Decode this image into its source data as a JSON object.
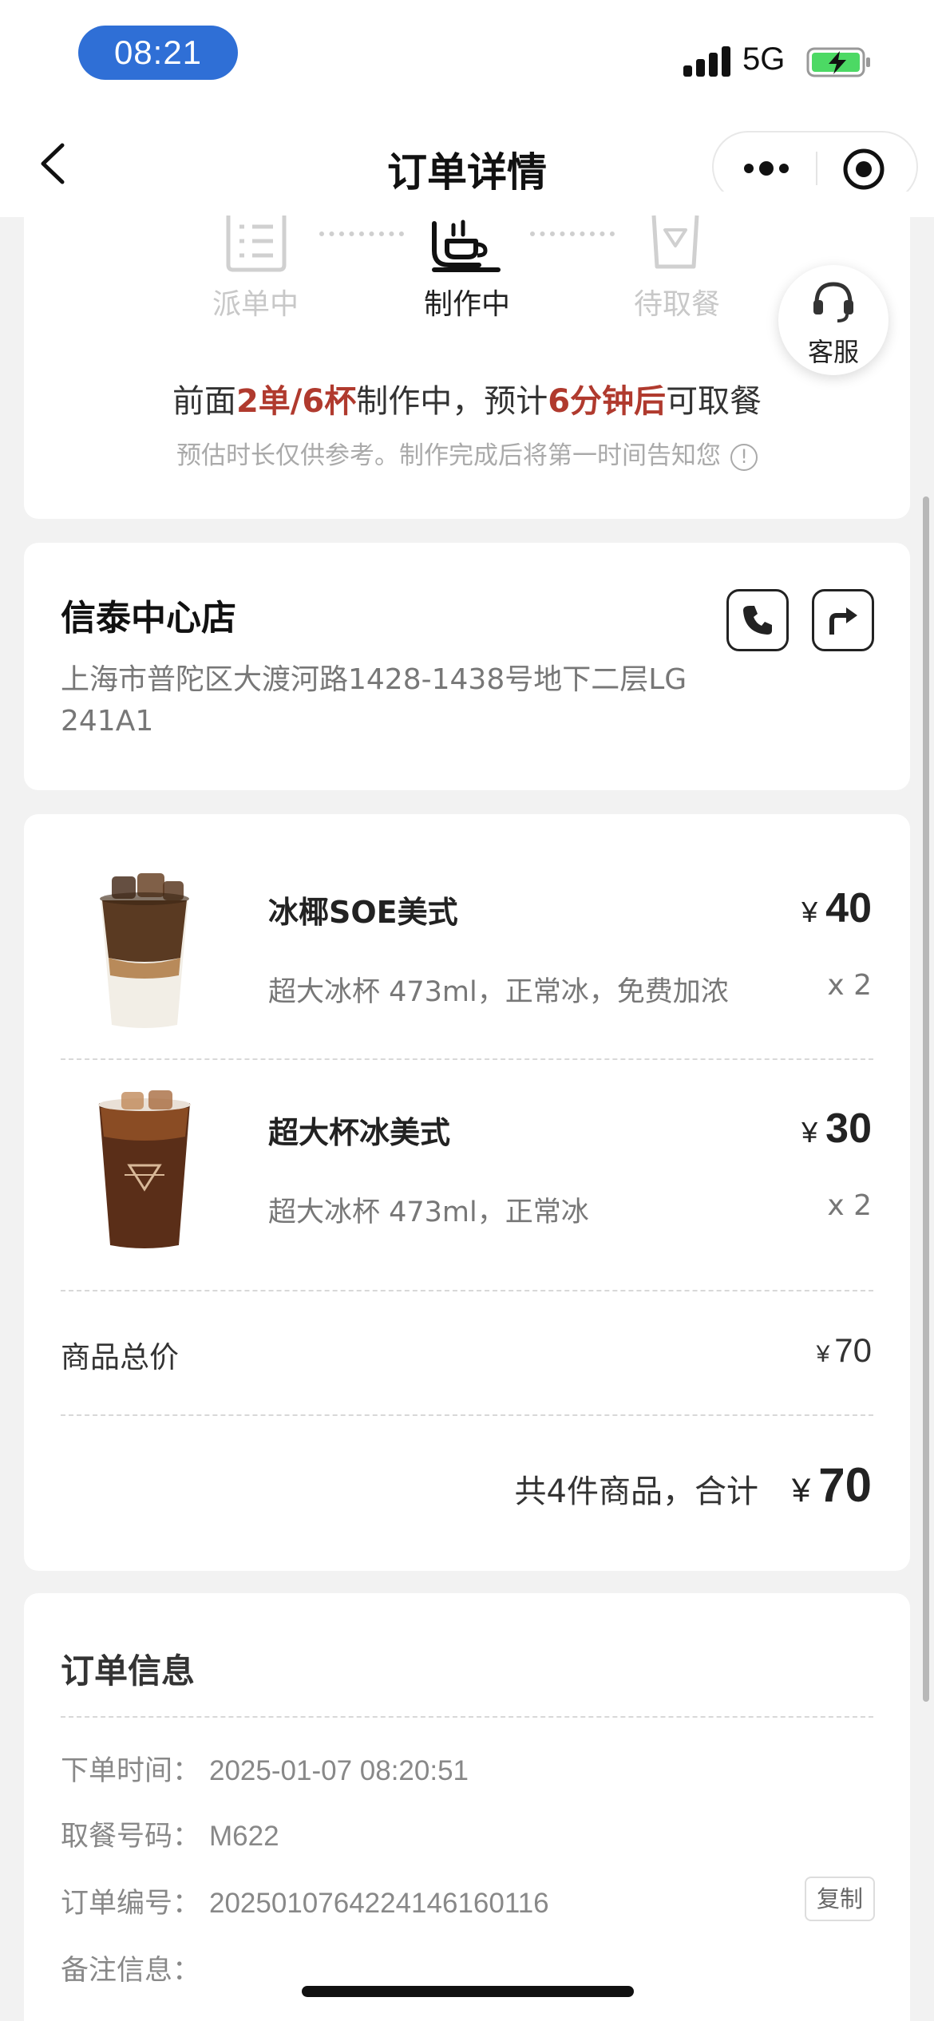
{
  "status_bar": {
    "time": "08:21",
    "network": "5G"
  },
  "nav": {
    "title": "订单详情"
  },
  "progress": {
    "steps": [
      {
        "label": "派单中",
        "icon": "list-icon",
        "state": "done"
      },
      {
        "label": "制作中",
        "icon": "coffee-cup-icon",
        "state": "active"
      },
      {
        "label": "待取餐",
        "icon": "cup-icon",
        "state": "pending"
      }
    ],
    "wait_prefix": "前面",
    "wait_count": "2单/6杯",
    "wait_middle": "制作中，预计",
    "wait_time": "6分钟后",
    "wait_suffix": "可取餐",
    "note": "预估时长仅供参考。制作完成后将第一时间告知您",
    "service_label": "客服"
  },
  "store": {
    "name": "信泰中心店",
    "address": "上海市普陀区大渡河路1428-1438号地下二层LG 241A1"
  },
  "items": [
    {
      "name": "冰椰SOE美式",
      "spec": "超大冰杯 473ml，正常冰，免费加浓",
      "currency": "¥",
      "price": "40",
      "qty": "x 2"
    },
    {
      "name": "超大杯冰美式",
      "spec": "超大冰杯 473ml，正常冰",
      "currency": "¥",
      "price": "30",
      "qty": "x 2"
    }
  ],
  "subtotal": {
    "label": "商品总价",
    "currency": "¥",
    "value": "70"
  },
  "total": {
    "label": "共4件商品，合计",
    "currency": "¥",
    "value": "70"
  },
  "order_info": {
    "title": "订单信息",
    "rows": [
      {
        "key": "下单时间：",
        "value": "2025-01-07 08:20:51"
      },
      {
        "key": "取餐号码：",
        "value": "M622"
      },
      {
        "key": "订单编号：",
        "value": "2025010764224146160116"
      },
      {
        "key": "备注信息：",
        "value": ""
      }
    ],
    "copy_label": "复制"
  },
  "colors": {
    "highlight": "#b03a2e",
    "time_pill": "#2f6fd6",
    "battery": "#4cd964"
  }
}
